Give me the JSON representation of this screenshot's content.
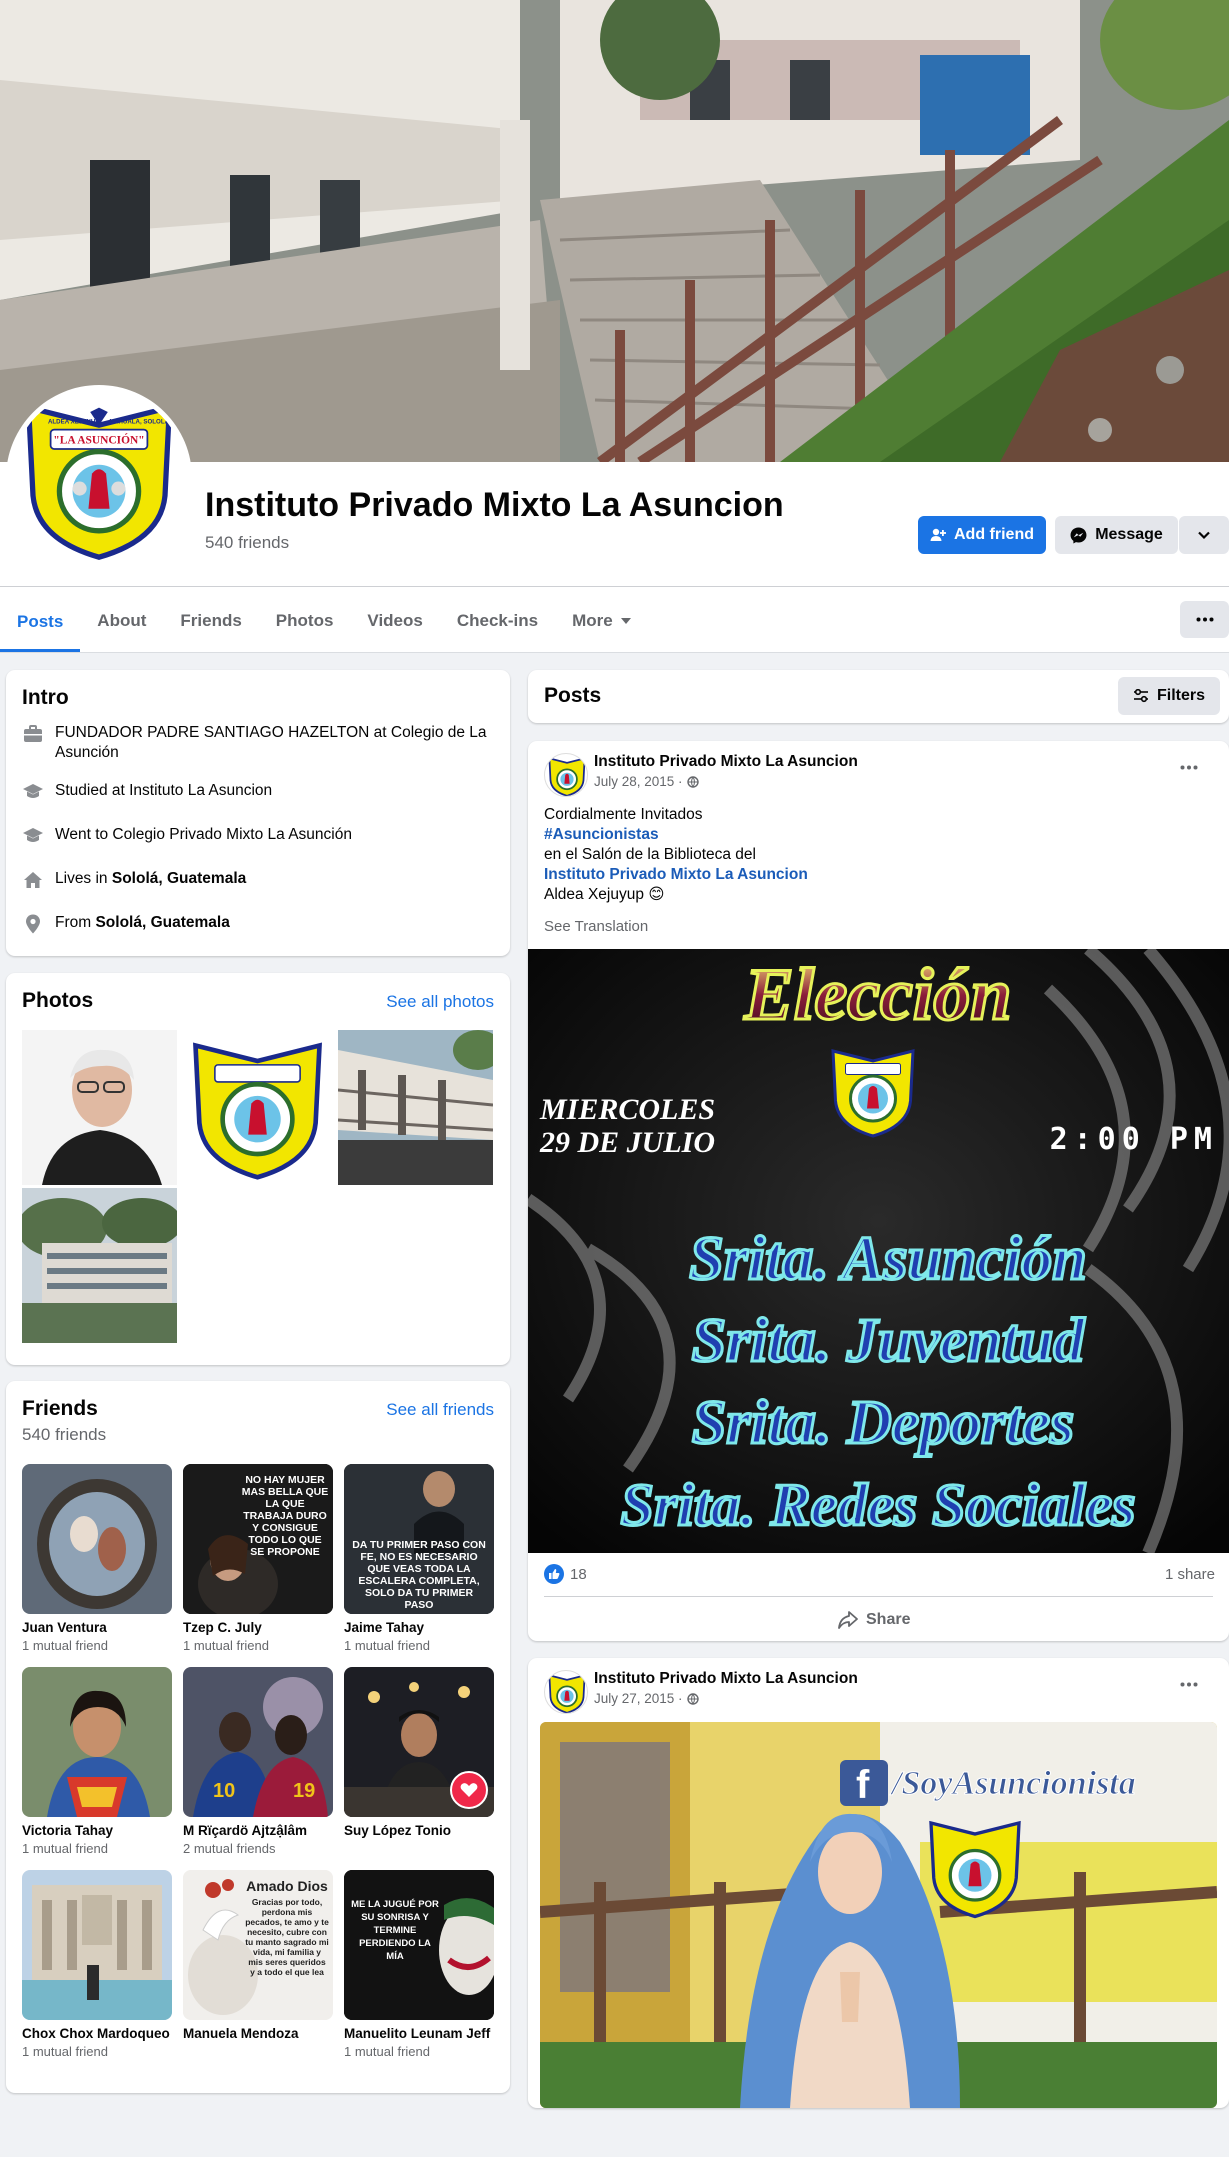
{
  "profile": {
    "name": "Instituto Privado Mixto La Asuncion",
    "friends_count": "540 friends"
  },
  "actions": {
    "add_friend": "Add friend",
    "message": "Message"
  },
  "tabs": [
    "Posts",
    "About",
    "Friends",
    "Photos",
    "Videos",
    "Check-ins",
    "More"
  ],
  "logo": {
    "top_left": "ALDEA XEJUYUP",
    "top_right": "NAHUALA, SOLOLA",
    "banner": "\"LA ASUNCIÓN\""
  },
  "intro": {
    "title": "Intro",
    "items": [
      {
        "icon": "briefcase-icon",
        "pre": "FUNDADOR PADRE SANTIAGO HAZELTON at Colegio de La Asunción",
        "bold": ""
      },
      {
        "icon": "graduation-cap-icon",
        "pre": "Studied at Instituto La Asuncion",
        "bold": ""
      },
      {
        "icon": "graduation-cap-icon",
        "pre": "Went to Colegio Privado Mixto La Asunción",
        "bold": ""
      },
      {
        "icon": "home-icon",
        "pre": "Lives in ",
        "bold": "Sololá, Guatemala"
      },
      {
        "icon": "location-pin-icon",
        "pre": "From ",
        "bold": "Sololá, Guatemala"
      }
    ]
  },
  "photos": {
    "title": "Photos",
    "see_all": "See all photos"
  },
  "friends": {
    "title": "Friends",
    "count": "540 friends",
    "see_all": "See all friends",
    "list": [
      {
        "name": "Juan Ventura",
        "mutual": "1 mutual friend"
      },
      {
        "name": "Tzep C. July",
        "mutual": "1 mutual friend"
      },
      {
        "name": "Jaime Tahay",
        "mutual": "1 mutual friend"
      },
      {
        "name": "Victoria Tahay",
        "mutual": "1 mutual friend"
      },
      {
        "name": "M Rïçardö Ajtzậlâm",
        "mutual": "2 mutual friends"
      },
      {
        "name": "Suy López Tonio",
        "mutual": ""
      },
      {
        "name": "Chox Chox Mardoqueo",
        "mutual": "1 mutual friend"
      },
      {
        "name": "Manuela Mendoza",
        "mutual": ""
      },
      {
        "name": "Manuelito Leunam Jeff",
        "mutual": "1 mutual friend"
      }
    ],
    "thumb_texts": {
      "tzep": "NO HAY MUJER MAS BELLA QUE LA QUE TRABAJA DURO Y CONSIGUE TODO LO QUE SE PROPONE",
      "jaime": "DA TU PRIMER PASO CON FE, NO ES NECESARIO QUE VEAS TODA LA ESCALERA COMPLETA, SOLO DA TU PRIMER PASO",
      "manuela_title": "Amado Dios",
      "manuela_body": "Gracias por todo, perdona mis pecados, te amo y te necesito, cubre con tu manto sagrado mi vida, mi familia y mis seres queridos y a todo el que lea",
      "manuelito": "ME LA JUGUÉ POR SU SONRISA Y TERMINE PERDIENDO LA MÍA"
    }
  },
  "posts_section": {
    "title": "Posts",
    "filters": "Filters"
  },
  "post1": {
    "author": "Instituto Privado Mixto La Asuncion",
    "date": "July 28, 2015 ·",
    "lines": [
      "Cordialmente Invitados",
      "#Asuncionistas",
      "en el Salón de la Biblioteca del",
      "Instituto Privado Mixto La Asuncion",
      "Aldea Xejuyup 😊"
    ],
    "see_translation": "See Translation",
    "image": {
      "heading": "Elección",
      "date_line1": "MIERCOLES",
      "date_line2": "29 DE JULIO",
      "time": "2:00 PM",
      "titles": [
        "Srita. Asunción",
        "Srita. Juventud",
        "Srita. Deportes",
        "Srita. Redes Sociales"
      ]
    },
    "likes": "18",
    "shares": "1 share",
    "share_label": "Share"
  },
  "post2": {
    "author": "Instituto Privado Mixto La Asuncion",
    "date": "July 27, 2015 ·",
    "image_text": "/SoyAsuncionista"
  },
  "colors": {
    "accent": "#1b74e4",
    "text_secondary": "#65676b",
    "background": "#f0f2f5"
  }
}
